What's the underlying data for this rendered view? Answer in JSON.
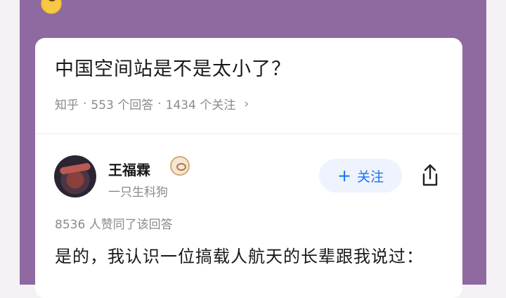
{
  "question": {
    "title": "中国空间站是不是太小了？",
    "source": "知乎",
    "answer_count": "553 个回答",
    "follower_count": "1434 个关注",
    "more_glyph": "›"
  },
  "author": {
    "name": "王福霖",
    "bio": "一只生科狗"
  },
  "actions": {
    "follow_icon": "+",
    "follow_label": "关注"
  },
  "answer": {
    "votes": "8536 人赞同了该回答",
    "text": "是的，我认识一位搞载人航天的长辈跟我说过："
  },
  "colors": {
    "frame": "#8e6aa0",
    "accent": "#1772f6"
  }
}
